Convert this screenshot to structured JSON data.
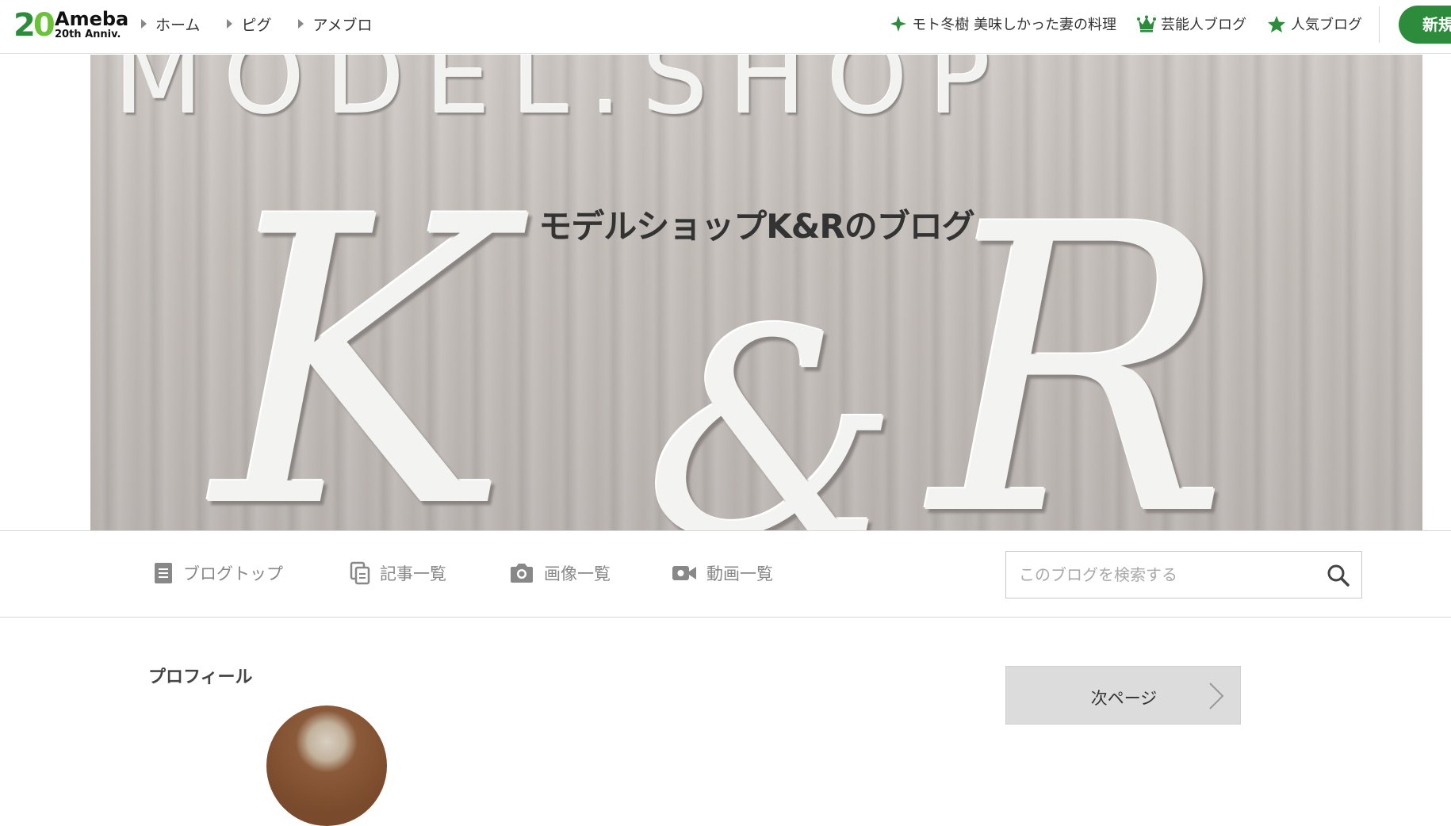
{
  "header": {
    "logo": {
      "name": "Ameba",
      "sub": "20th Anniv.",
      "number": "20"
    },
    "nav": [
      {
        "label": "ホーム"
      },
      {
        "label": "ピグ"
      },
      {
        "label": "アメブロ"
      }
    ],
    "right_nav": [
      {
        "icon": "sparkle-icon",
        "label": "モト冬樹 美味しかった妻の料理",
        "color": "#2d8c3c"
      },
      {
        "icon": "crown-icon",
        "label": "芸能人ブログ",
        "color": "#2d8c3c"
      },
      {
        "icon": "star-icon",
        "label": "人気ブログ",
        "color": "#2d8c3c"
      }
    ],
    "new_button": "新規"
  },
  "hero": {
    "title": "モデルショップK&Rのブログ",
    "sign_top": "MODEL.SHOP",
    "sign_k": "K",
    "sign_amp": "&",
    "sign_r": "R"
  },
  "subnav": {
    "items": [
      {
        "icon": "document-icon",
        "label": "ブログトップ"
      },
      {
        "icon": "copy-icon",
        "label": "記事一覧"
      },
      {
        "icon": "camera-icon",
        "label": "画像一覧"
      },
      {
        "icon": "video-icon",
        "label": "動画一覧"
      }
    ],
    "search": {
      "placeholder": "このブログを検索する",
      "value": ""
    }
  },
  "content": {
    "profile_heading": "プロフィール",
    "next_page": "次ページ"
  },
  "colors": {
    "brand": "#2d8c3c",
    "brand_light": "#6cc23a",
    "text": "#333333",
    "muted": "#888888"
  }
}
